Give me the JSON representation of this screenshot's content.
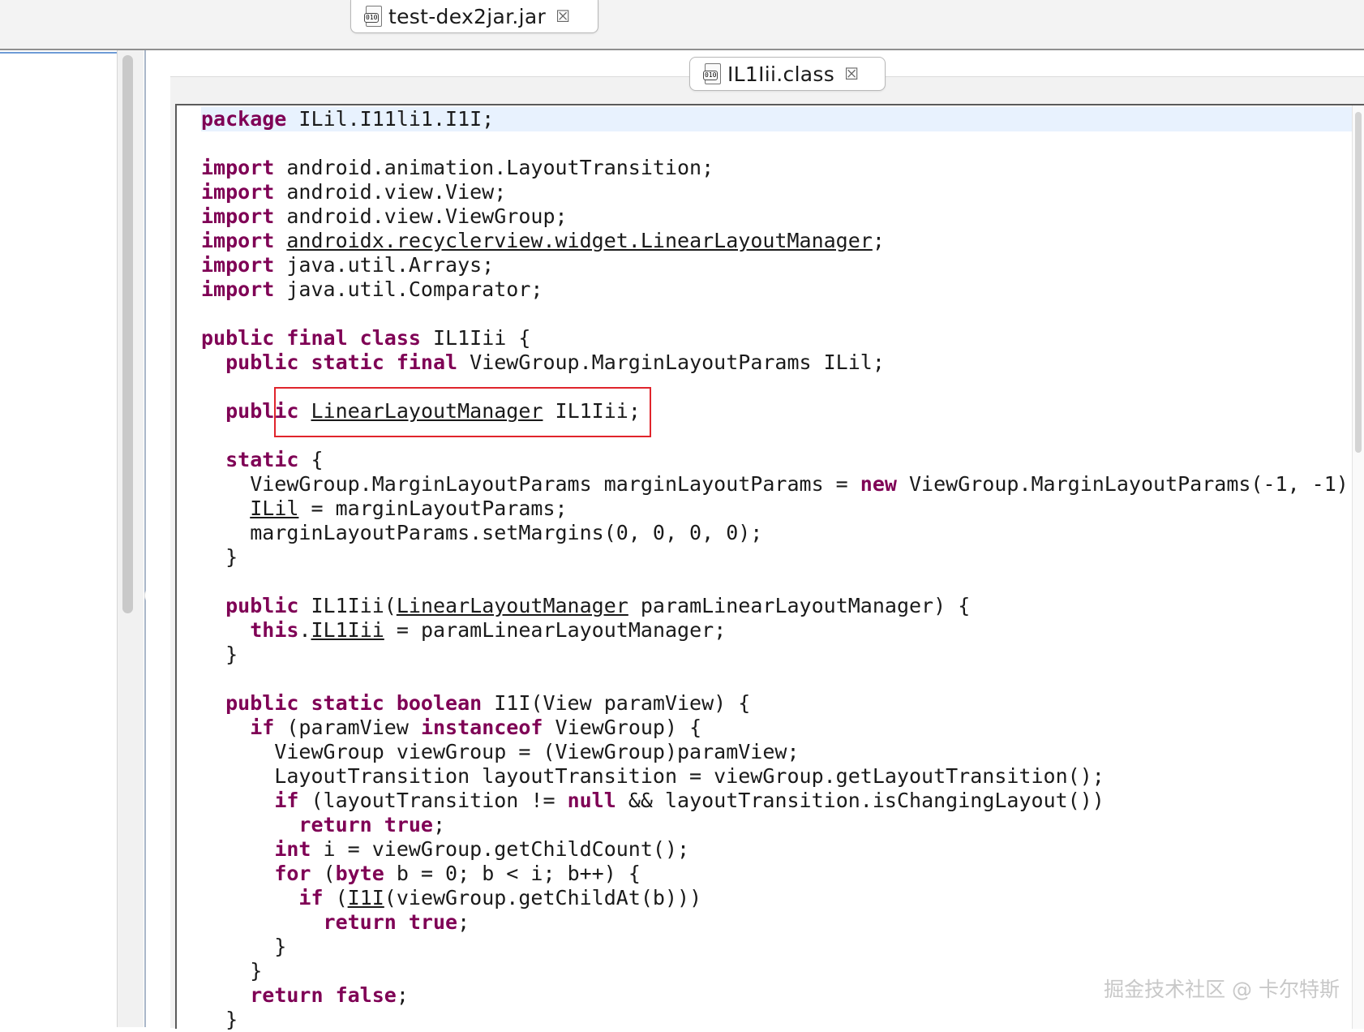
{
  "outer_tab": {
    "icon": "class-file-icon",
    "icon_glyph": "010",
    "label": "test-dex2jar.jar",
    "close_glyph": "☒"
  },
  "inner_tab": {
    "icon": "class-file-icon",
    "icon_glyph": "010",
    "label": "IL1Iii.class",
    "close_glyph": "☒"
  },
  "editor": {
    "keyword_color": "#7f0055",
    "highlight_color": "#e8f2fe",
    "callout_color": "#e0242c",
    "lines": [
      [
        {
          "t": "package",
          "k": "kw"
        },
        {
          "t": " ILil.I11li1.I1I;"
        }
      ],
      [],
      [
        {
          "t": "import",
          "k": "kw"
        },
        {
          "t": " android.animation.LayoutTransition;"
        }
      ],
      [
        {
          "t": "import",
          "k": "kw"
        },
        {
          "t": " android.view.View;"
        }
      ],
      [
        {
          "t": "import",
          "k": "kw"
        },
        {
          "t": " android.view.ViewGroup;"
        }
      ],
      [
        {
          "t": "import",
          "k": "kw"
        },
        {
          "t": " "
        },
        {
          "t": "androidx.recyclerview.widget.LinearLayoutManager",
          "k": "u"
        },
        {
          "t": ";"
        }
      ],
      [
        {
          "t": "import",
          "k": "kw"
        },
        {
          "t": " java.util.Arrays;"
        }
      ],
      [
        {
          "t": "import",
          "k": "kw"
        },
        {
          "t": " java.util.Comparator;"
        }
      ],
      [],
      [
        {
          "t": "public final class",
          "k": "kw"
        },
        {
          "t": " IL1Iii {"
        }
      ],
      [
        {
          "t": "  "
        },
        {
          "t": "public static final",
          "k": "kw"
        },
        {
          "t": " ViewGroup.MarginLayoutParams ILil;"
        }
      ],
      [],
      [
        {
          "t": "  "
        },
        {
          "t": "public",
          "k": "kw"
        },
        {
          "t": " "
        },
        {
          "t": "LinearLayoutManager",
          "k": "u"
        },
        {
          "t": " IL1Iii;"
        }
      ],
      [],
      [
        {
          "t": "  "
        },
        {
          "t": "static",
          "k": "kw"
        },
        {
          "t": " {"
        }
      ],
      [
        {
          "t": "    ViewGroup.MarginLayoutParams marginLayoutParams = "
        },
        {
          "t": "new",
          "k": "kw"
        },
        {
          "t": " ViewGroup.MarginLayoutParams(-1, -1);"
        }
      ],
      [
        {
          "t": "    "
        },
        {
          "t": "ILil",
          "k": "u"
        },
        {
          "t": " = marginLayoutParams;"
        }
      ],
      [
        {
          "t": "    marginLayoutParams.setMargins(0, 0, 0, 0);"
        }
      ],
      [
        {
          "t": "  }"
        }
      ],
      [],
      [
        {
          "t": "  "
        },
        {
          "t": "public",
          "k": "kw"
        },
        {
          "t": " IL1Iii("
        },
        {
          "t": "LinearLayoutManager",
          "k": "u"
        },
        {
          "t": " paramLinearLayoutManager) {"
        }
      ],
      [
        {
          "t": "    "
        },
        {
          "t": "this",
          "k": "kw"
        },
        {
          "t": "."
        },
        {
          "t": "IL1Iii",
          "k": "u"
        },
        {
          "t": " = paramLinearLayoutManager;"
        }
      ],
      [
        {
          "t": "  }"
        }
      ],
      [],
      [
        {
          "t": "  "
        },
        {
          "t": "public static boolean",
          "k": "kw"
        },
        {
          "t": " I1I(View paramView) {"
        }
      ],
      [
        {
          "t": "    "
        },
        {
          "t": "if",
          "k": "kw"
        },
        {
          "t": " (paramView "
        },
        {
          "t": "instanceof",
          "k": "kw"
        },
        {
          "t": " ViewGroup) {"
        }
      ],
      [
        {
          "t": "      ViewGroup viewGroup = (ViewGroup)paramView;"
        }
      ],
      [
        {
          "t": "      LayoutTransition layoutTransition = viewGroup.getLayoutTransition();"
        }
      ],
      [
        {
          "t": "      "
        },
        {
          "t": "if",
          "k": "kw"
        },
        {
          "t": " (layoutTransition != "
        },
        {
          "t": "null",
          "k": "kw"
        },
        {
          "t": " && layoutTransition.isChangingLayout())"
        }
      ],
      [
        {
          "t": "        "
        },
        {
          "t": "return true",
          "k": "kw"
        },
        {
          "t": ";"
        }
      ],
      [
        {
          "t": "      "
        },
        {
          "t": "int",
          "k": "kw"
        },
        {
          "t": " i = viewGroup.getChildCount();"
        }
      ],
      [
        {
          "t": "      "
        },
        {
          "t": "for",
          "k": "kw"
        },
        {
          "t": " ("
        },
        {
          "t": "byte",
          "k": "kw"
        },
        {
          "t": " b = 0; b < i; b++) {"
        }
      ],
      [
        {
          "t": "        "
        },
        {
          "t": "if",
          "k": "kw"
        },
        {
          "t": " ("
        },
        {
          "t": "I1I",
          "k": "u"
        },
        {
          "t": "(viewGroup.getChildAt(b)))"
        }
      ],
      [
        {
          "t": "          "
        },
        {
          "t": "return true",
          "k": "kw"
        },
        {
          "t": ";"
        }
      ],
      [
        {
          "t": "      }"
        }
      ],
      [
        {
          "t": "    }"
        }
      ],
      [
        {
          "t": "    "
        },
        {
          "t": "return false",
          "k": "kw"
        },
        {
          "t": ";"
        }
      ],
      [
        {
          "t": "  }"
        }
      ]
    ]
  },
  "watermark": "掘金技术社区 @ 卡尔特斯"
}
